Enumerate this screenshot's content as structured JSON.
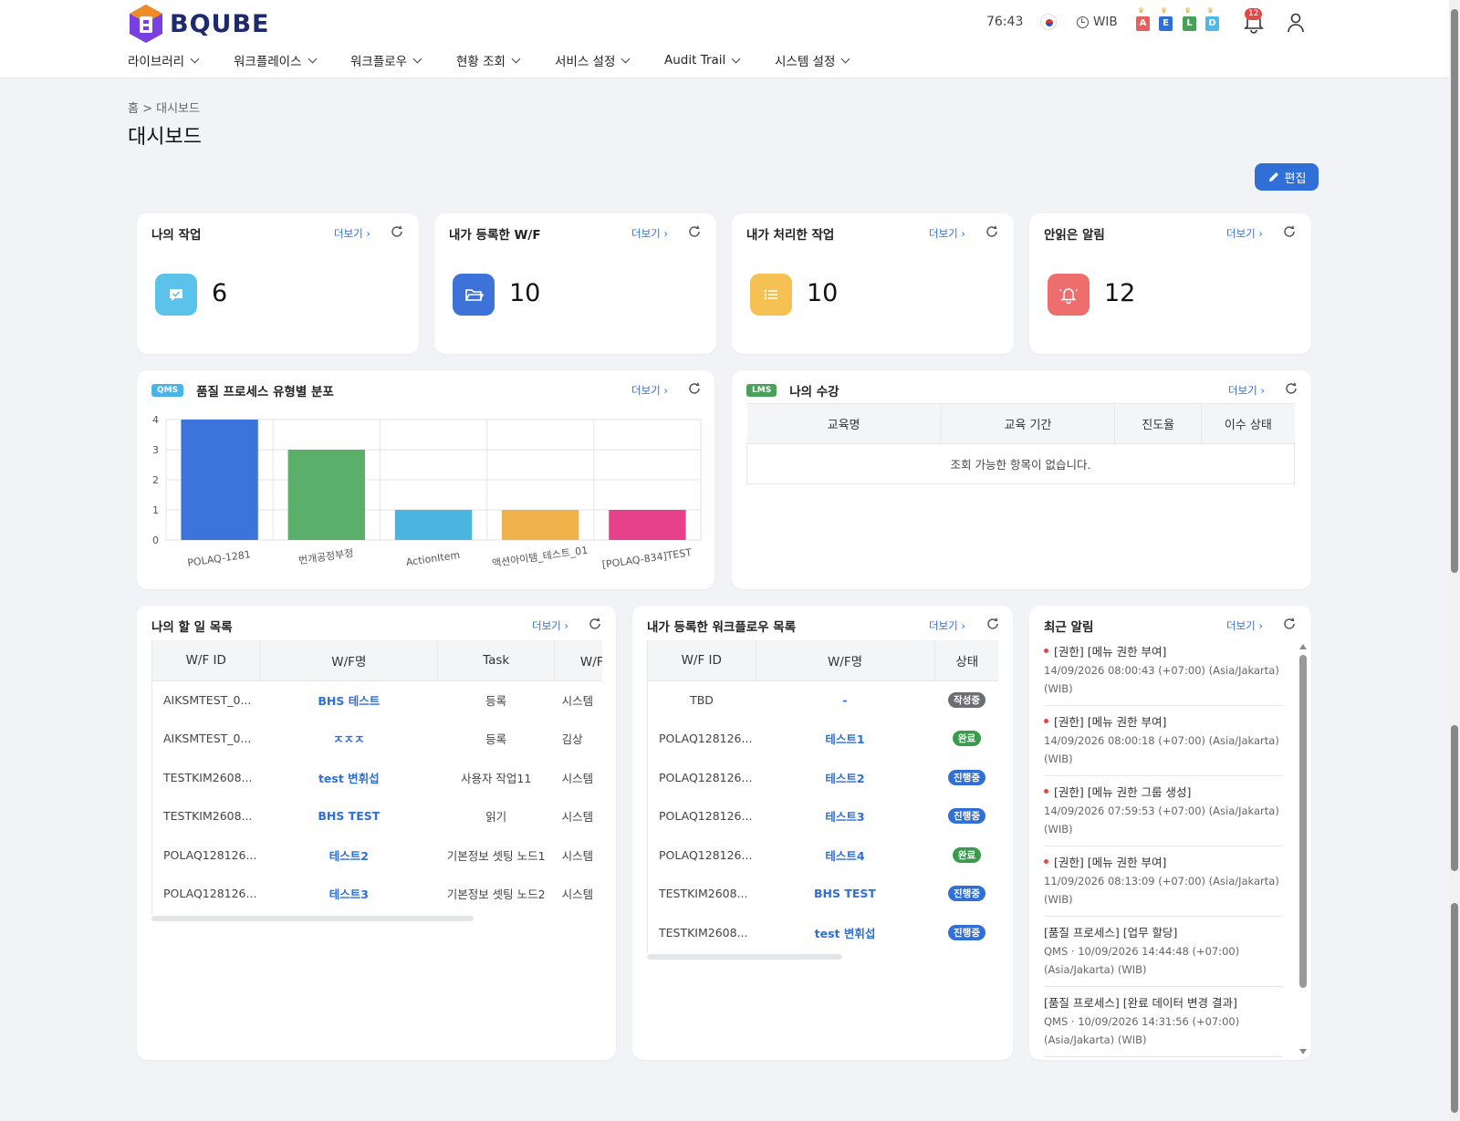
{
  "header": {
    "logo_text": "BQUBE",
    "timer": "76:43",
    "timezone": "WIB",
    "badges": [
      {
        "letter": "A",
        "color": "#e85d5d"
      },
      {
        "letter": "E",
        "color": "#2f6fd6"
      },
      {
        "letter": "L",
        "color": "#4aa05a"
      },
      {
        "letter": "D",
        "color": "#4fb8e6"
      }
    ],
    "notification_count": "12"
  },
  "nav": {
    "items": [
      "라이브러리",
      "워크플레이스",
      "워크플로우",
      "현황 조회",
      "서비스 설정",
      "Audit Trail",
      "시스템 설정"
    ]
  },
  "page": {
    "breadcrumb": "홈 > 대시보드",
    "title": "대시보드",
    "edit_label": "편집"
  },
  "common": {
    "more_label": "더보기 ›"
  },
  "stats": [
    {
      "title": "나의 작업",
      "value": "6",
      "color": "#5bc3ea",
      "icon": "chat-check-icon"
    },
    {
      "title": "내가 등록한 W/F",
      "value": "10",
      "color": "#3d72d8",
      "icon": "folder-open-icon"
    },
    {
      "title": "내가 처리한 작업",
      "value": "10",
      "color": "#f5c152",
      "icon": "list-icon"
    },
    {
      "title": "안읽은 알림",
      "value": "12",
      "color": "#ee6e6e",
      "icon": "bell-ring-icon"
    }
  ],
  "qms_chart": {
    "tag": "QMS",
    "tag_color": "#4bb4e6",
    "title": "품질 프로세스 유형별 분포"
  },
  "chart_data": {
    "type": "bar",
    "categories": [
      "POLAQ-1281",
      "번개공정부정",
      "ActionItem",
      "액션아이템_테스트_01",
      "[POLAQ-834]TEST"
    ],
    "values": [
      4,
      3,
      1,
      1,
      1
    ],
    "colors": [
      "#3c74dc",
      "#5aaf6a",
      "#4bb4e0",
      "#f0b24a",
      "#e6418a"
    ],
    "ylim": [
      0,
      4
    ],
    "yticks": [
      "0",
      "1",
      "2",
      "3",
      "4"
    ],
    "grid": true
  },
  "lms": {
    "tag": "LMS",
    "tag_color": "#4aa05a",
    "title": "나의 수강",
    "columns": [
      "교육명",
      "교육 기간",
      "진도율",
      "이수 상태"
    ],
    "empty_text": "조회 가능한 항목이 없습니다."
  },
  "todo": {
    "title": "나의 할 일 목록",
    "columns": [
      "W/F ID",
      "W/F명",
      "Task",
      "W/F 작"
    ],
    "rows": [
      {
        "id": "AIKSMTEST_0...",
        "name": "BHS 테스트",
        "task": "등록",
        "owner": "시스템"
      },
      {
        "id": "AIKSMTEST_0...",
        "name": "ㅈㅈㅈ",
        "task": "등록",
        "owner": "김상"
      },
      {
        "id": "TESTKIM2608...",
        "name": "test 변휘섭",
        "task": "사용자 작업11",
        "owner": "시스템"
      },
      {
        "id": "TESTKIM2608...",
        "name": "BHS TEST",
        "task": "읽기",
        "owner": "시스템"
      },
      {
        "id": "POLAQ128126...",
        "name": "테스트2",
        "task": "기본정보 셋팅 노드1",
        "owner": "시스템"
      },
      {
        "id": "POLAQ128126...",
        "name": "테스트3",
        "task": "기본정보 셋팅 노드2",
        "owner": "시스템"
      }
    ]
  },
  "my_wf": {
    "title": "내가 등록한 워크플로우 목록",
    "columns": [
      "W/F ID",
      "W/F명",
      "상태"
    ],
    "rows": [
      {
        "id": "TBD",
        "name": "-",
        "status": "작성중",
        "status_color": "#6b6f75"
      },
      {
        "id": "POLAQ128126...",
        "name": "테스트1",
        "status": "완료",
        "status_color": "#3a9a4e"
      },
      {
        "id": "POLAQ128126...",
        "name": "테스트2",
        "status": "진행중",
        "status_color": "#2f6fd6"
      },
      {
        "id": "POLAQ128126...",
        "name": "테스트3",
        "status": "진행중",
        "status_color": "#2f6fd6"
      },
      {
        "id": "POLAQ128126...",
        "name": "테스트4",
        "status": "완료",
        "status_color": "#3a9a4e"
      },
      {
        "id": "TESTKIM2608...",
        "name": "BHS TEST",
        "status": "진행중",
        "status_color": "#2f6fd6"
      },
      {
        "id": "TESTKIM2608...",
        "name": "test 변휘섭",
        "status": "진행중",
        "status_color": "#2f6fd6"
      }
    ]
  },
  "recent": {
    "title": "최근 알림",
    "items": [
      {
        "title": "[권한] [메뉴 권한 부여]",
        "detail": "14/09/2026 08:00:43 (+07:00) (Asia/Jakarta) (WIB)",
        "unread": true
      },
      {
        "title": "[권한] [메뉴 권한 부여]",
        "detail": "14/09/2026 08:00:18 (+07:00) (Asia/Jakarta) (WIB)",
        "unread": true
      },
      {
        "title": "[권한] [메뉴 권한 그룹 생성]",
        "detail": "14/09/2026 07:59:53 (+07:00) (Asia/Jakarta) (WIB)",
        "unread": true
      },
      {
        "title": "[권한] [메뉴 권한 부여]",
        "detail": "11/09/2026 08:13:09 (+07:00) (Asia/Jakarta) (WIB)",
        "unread": true
      },
      {
        "title": "[품질 프로세스] [업무 할당]",
        "detail": "QMS · 10/09/2026 14:44:48 (+07:00) (Asia/Jakarta) (WIB)",
        "unread": false
      },
      {
        "title": "[품질 프로세스] [완료 데이터 변경 결과]",
        "detail": "QMS · 10/09/2026 14:31:56 (+07:00) (Asia/Jakarta) (WIB)",
        "unread": false
      }
    ]
  }
}
